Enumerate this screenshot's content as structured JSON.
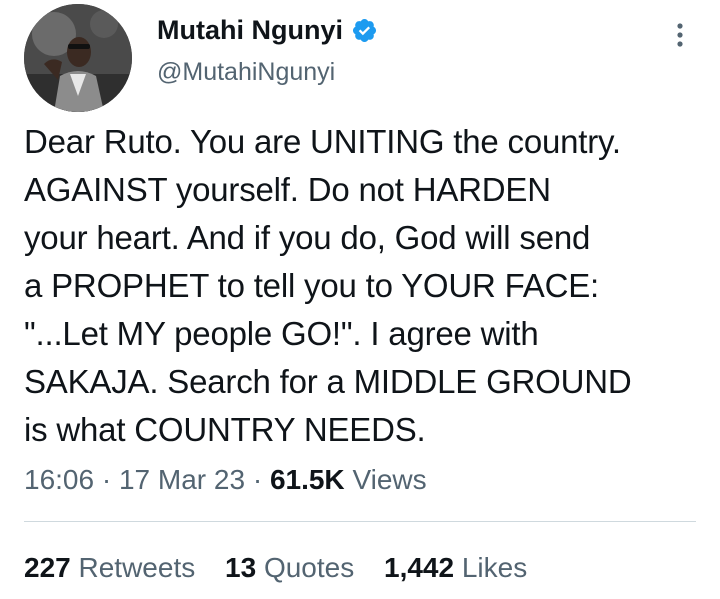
{
  "author": {
    "display_name": "Mutahi Ngunyi",
    "handle": "@MutahiNgunyi",
    "verified": true,
    "verified_icon": "verified-badge-icon",
    "verified_color": "#1d9bf0"
  },
  "tweet": {
    "text": "Dear Ruto. You are UNITING the country.\nAGAINST yourself. Do not HARDEN\nyour heart. And if you do, God will send\na PROPHET to tell you to YOUR FACE:\n\"...Let MY people GO!\". I agree with\nSAKAJA. Search for a MIDDLE GROUND\nis what COUNTRY NEEDS."
  },
  "meta": {
    "time": "16:06",
    "separator": "·",
    "date": "17 Mar 23",
    "views_count": "61.5K",
    "views_label": "Views"
  },
  "stats": {
    "retweets_count": "227",
    "retweets_label": "Retweets",
    "quotes_count": "13",
    "quotes_label": "Quotes",
    "likes_count": "1,442",
    "likes_label": "Likes"
  },
  "icons": {
    "more": "more-vertical-icon",
    "avatar": "profile-avatar"
  },
  "colors": {
    "text_primary": "#0f1419",
    "text_secondary": "#536471",
    "divider": "#cfd9de"
  }
}
